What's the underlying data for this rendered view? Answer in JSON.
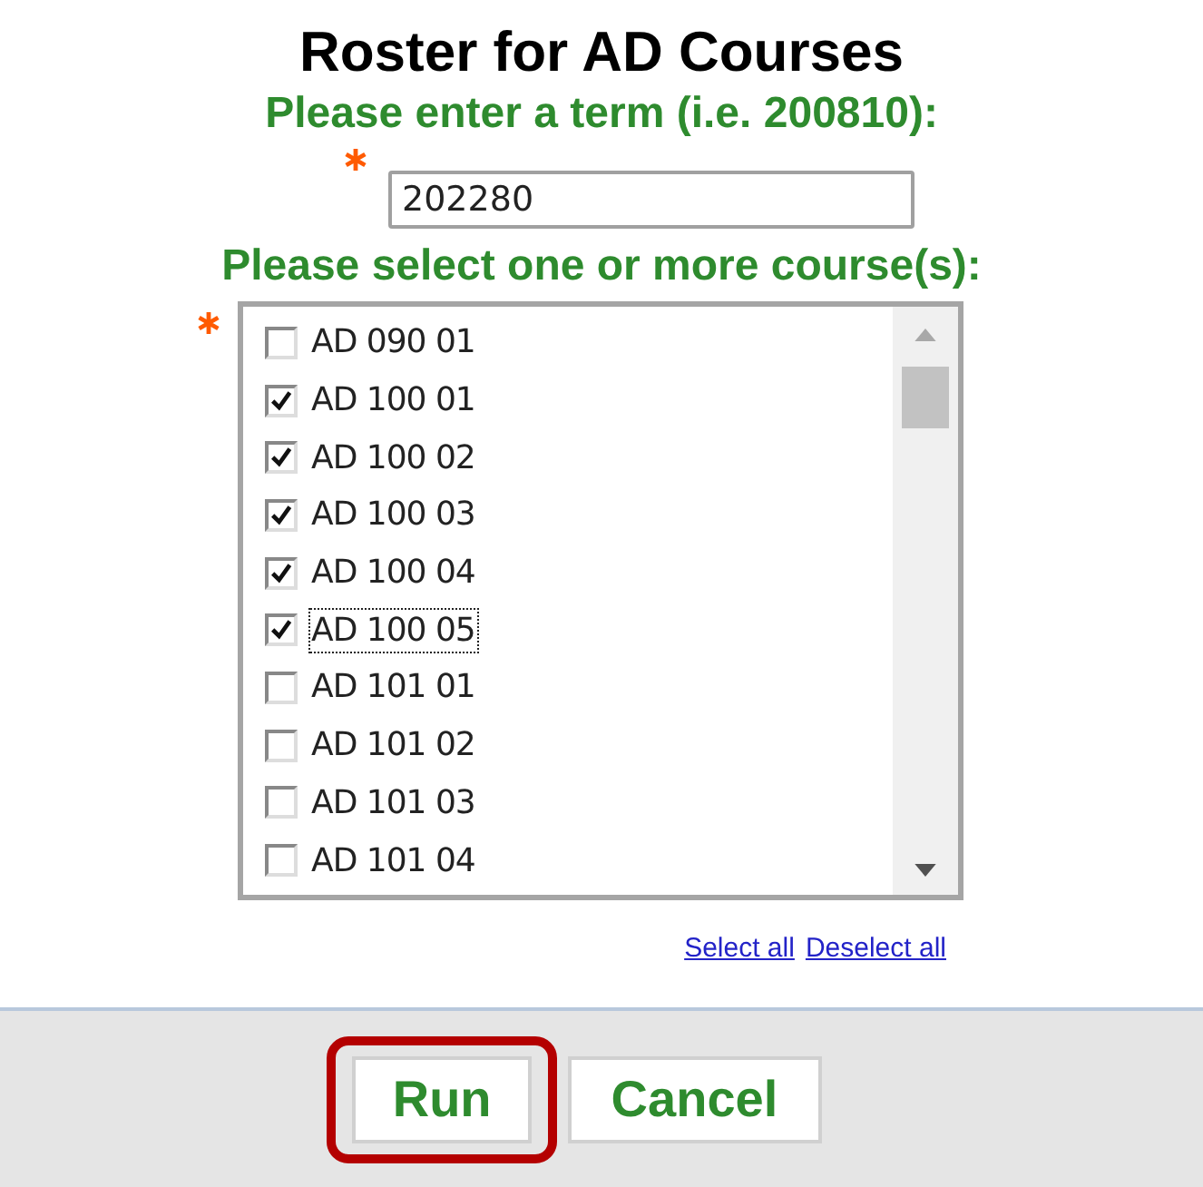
{
  "title": "Roster for AD Courses",
  "term": {
    "label": "Please enter a term (i.e. 200810):",
    "required": true,
    "value": "202280"
  },
  "courses": {
    "label": "Please select one or more course(s):",
    "required": true,
    "items": [
      {
        "label": "AD 090 01",
        "checked": false,
        "focused": false
      },
      {
        "label": "AD 100 01",
        "checked": true,
        "focused": false
      },
      {
        "label": "AD 100 02",
        "checked": true,
        "focused": false
      },
      {
        "label": "AD 100 03",
        "checked": true,
        "focused": false
      },
      {
        "label": "AD 100 04",
        "checked": true,
        "focused": false
      },
      {
        "label": "AD 100 05",
        "checked": true,
        "focused": true
      },
      {
        "label": "AD 101 01",
        "checked": false,
        "focused": false
      },
      {
        "label": "AD 101 02",
        "checked": false,
        "focused": false
      },
      {
        "label": "AD 101 03",
        "checked": false,
        "focused": false
      },
      {
        "label": "AD 101 04",
        "checked": false,
        "focused": false
      }
    ]
  },
  "links": [
    "Select all",
    "Deselect all"
  ],
  "buttons": [
    {
      "label": "Run",
      "highlighted": true
    },
    {
      "label": "Cancel",
      "highlighted": false
    }
  ]
}
